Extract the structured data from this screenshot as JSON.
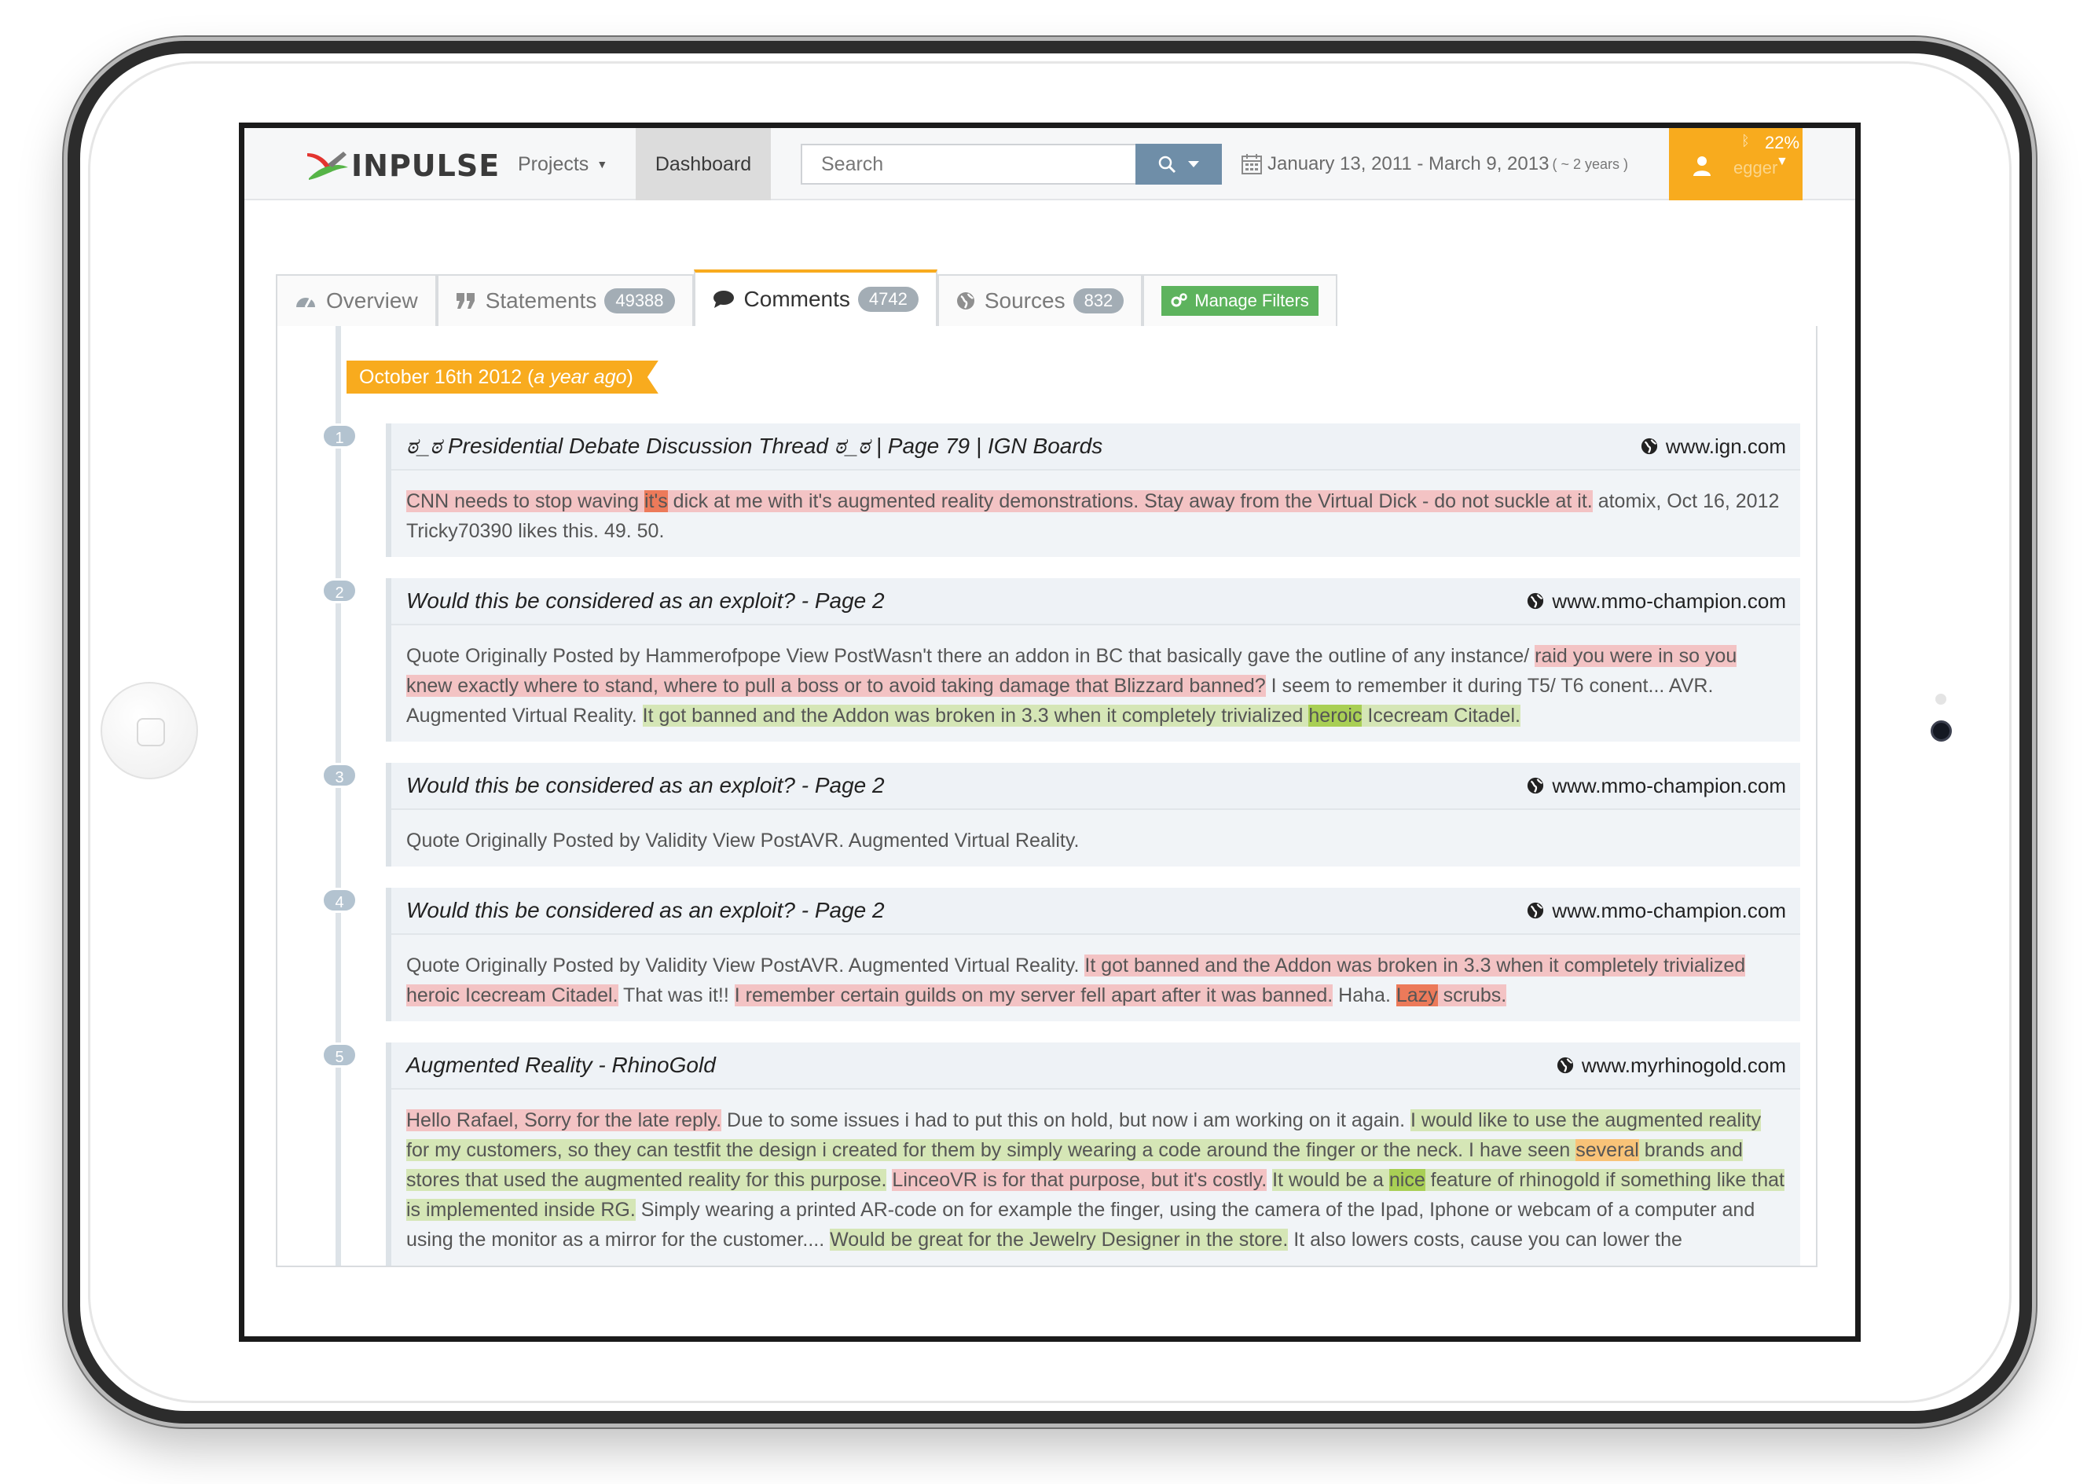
{
  "app": {
    "logo_text": "INPULSE",
    "brand_color": "#f8ab1e"
  },
  "topbar": {
    "projects_label": "Projects",
    "dashboard_label": "Dashboard",
    "search_placeholder": "Search",
    "date_range": "January 13, 2011 - March 9, 2013",
    "date_span": "( ~ 2 years )",
    "battery": "22%",
    "username": "egger"
  },
  "tabs": [
    {
      "label": "Overview",
      "icon": "dashboard-icon",
      "badge": ""
    },
    {
      "label": "Statements",
      "icon": "quote-icon",
      "badge": "49388"
    },
    {
      "label": "Comments",
      "icon": "comment-icon",
      "badge": "4742"
    },
    {
      "label": "Sources",
      "icon": "globe-icon",
      "badge": "832"
    }
  ],
  "manage_filters_label": "Manage Filters",
  "timeline": {
    "date_label": "October 16th 2012",
    "date_relative": "a year ago"
  },
  "entries": [
    {
      "number": "1",
      "title": "ಠ_ಠ Presidential Debate Discussion Thread ಠ_ಠ | Page 79 | IGN Boards",
      "source": "www.ign.com",
      "segments": [
        {
          "text": "CNN needs to stop waving ",
          "hl": "red"
        },
        {
          "text": "it's",
          "hl": "word-red"
        },
        {
          "text": " dick at me with it's augmented reality demonstrations. Stay away from the Virtual Dick - do not suckle at it.",
          "hl": "red"
        },
        {
          "text": " atomix, Oct 16, 2012 Tricky70390 likes this. 49. 50.",
          "hl": ""
        }
      ]
    },
    {
      "number": "2",
      "title": "Would this be considered as an exploit? - Page 2",
      "source": "www.mmo-champion.com",
      "segments": [
        {
          "text": "Quote Originally Posted by Hammerofpope View PostWasn't there an addon in BC that basically gave the outline of any instance/ ",
          "hl": ""
        },
        {
          "text": "raid you were in so you knew exactly where to stand, where to pull a boss or to avoid taking damage that Blizzard banned?",
          "hl": "red"
        },
        {
          "text": " I seem to remember it during T5/ T6 conent... AVR. Augmented Virtual Reality. ",
          "hl": ""
        },
        {
          "text": "It got banned and the Addon was broken in 3.3 when it completely trivialized ",
          "hl": "green"
        },
        {
          "text": "heroic",
          "hl": "word-green"
        },
        {
          "text": " Icecream Citadel.",
          "hl": "green"
        }
      ]
    },
    {
      "number": "3",
      "title": "Would this be considered as an exploit? - Page 2",
      "source": "www.mmo-champion.com",
      "segments": [
        {
          "text": "Quote Originally Posted by Validity View PostAVR. Augmented Virtual Reality.",
          "hl": ""
        }
      ]
    },
    {
      "number": "4",
      "title": "Would this be considered as an exploit? - Page 2",
      "source": "www.mmo-champion.com",
      "segments": [
        {
          "text": "Quote Originally Posted by Validity View PostAVR. Augmented Virtual Reality. ",
          "hl": ""
        },
        {
          "text": "It got banned and the Addon was broken in 3.3 when it completely trivialized heroic Icecream Citadel.",
          "hl": "red"
        },
        {
          "text": " That was it!! ",
          "hl": ""
        },
        {
          "text": "I remember certain guilds on my server fell apart after it was banned.",
          "hl": "red"
        },
        {
          "text": " Haha. ",
          "hl": ""
        },
        {
          "text": "Lazy",
          "hl": "word-red"
        },
        {
          "text": " scrubs.",
          "hl": "red"
        }
      ]
    },
    {
      "number": "5",
      "title": "Augmented Reality - RhinoGold",
      "source": "www.myrhinogold.com",
      "segments": [
        {
          "text": "Hello Rafael, Sorry for the late reply.",
          "hl": "red"
        },
        {
          "text": " Due to some issues i had to put this on hold, but now i am working on it again. ",
          "hl": ""
        },
        {
          "text": "I would like to use the augmented reality for my customers, so they can testfit the design i created for them by simply wearing a code around the finger or the neck. I have seen ",
          "hl": "green"
        },
        {
          "text": "several",
          "hl": "word-orange"
        },
        {
          "text": " brands and stores that used the augmented reality for this purpose.",
          "hl": "green"
        },
        {
          "text": " ",
          "hl": ""
        },
        {
          "text": "LinceoVR is for that purpose, but it's costly.",
          "hl": "red"
        },
        {
          "text": " ",
          "hl": ""
        },
        {
          "text": "It would be a ",
          "hl": "green"
        },
        {
          "text": "nice",
          "hl": "word-green"
        },
        {
          "text": " feature of rhinogold if something like that is implemented inside RG.",
          "hl": "green"
        },
        {
          "text": " Simply wearing a printed AR-code on for example the finger, using the camera of the Ipad, Iphone or webcam of a computer and using the monitor as a mirror for the customer.... ",
          "hl": ""
        },
        {
          "text": "Would be great for the Jewelry Designer in the store.",
          "hl": "green"
        },
        {
          "text": " It also lowers costs, cause you can lower the",
          "hl": ""
        }
      ]
    }
  ]
}
